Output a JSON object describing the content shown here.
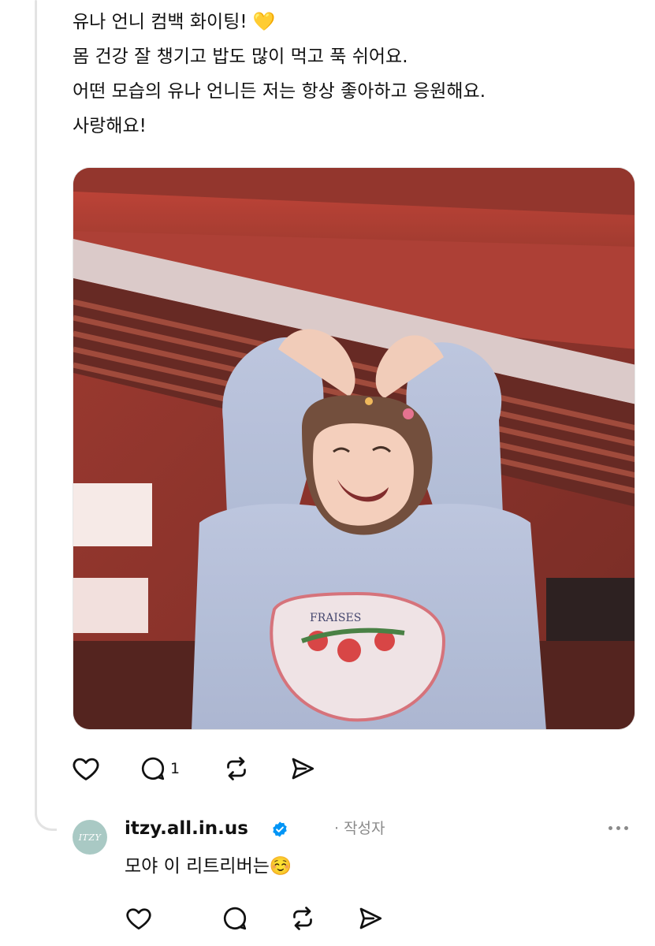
{
  "post": {
    "lines": [
      "유나 언니 컴백 화이팅! 💛",
      "몸 건강 잘 챙기고 밥도 많이 먹고 푹 쉬어요.",
      "어떤 모습의 유나 언니든 저는 항상 좋아하고 응원해요.",
      "사랑해요!"
    ],
    "reply_count": "1"
  },
  "media": {
    "shirt_text": "FRAISES"
  },
  "reply": {
    "avatar_text": "ITZY",
    "username": "itzy.all.in.us",
    "author_tag": "· 작성자",
    "text": "모야 이 리트리버는☺️"
  },
  "icons": {
    "like": "heart-icon",
    "comment": "comment-icon",
    "repost": "repost-icon",
    "share": "send-icon",
    "verified": "verified-badge-icon",
    "more": "more-dots-icon"
  },
  "colors": {
    "verified": "#0095f6",
    "muted": "#8a8a8a",
    "thread_line": "#e3e3e3"
  }
}
